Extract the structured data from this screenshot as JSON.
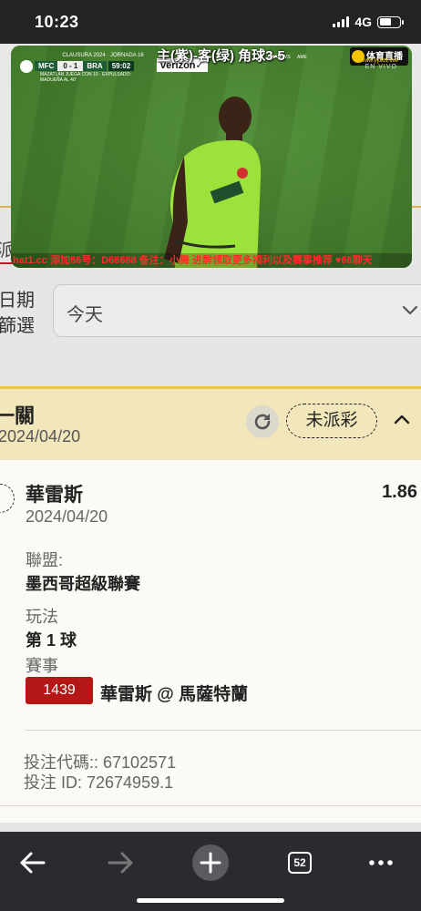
{
  "status_bar": {
    "time": "10:23",
    "network": "4G",
    "battery_level": 0.6
  },
  "video": {
    "title": "主(紫)-客(绿) 角球3-5",
    "scorebug": {
      "league": "CLAUSURA 2024 · JORNADA 16",
      "home": "MFC",
      "score": "0 - 1",
      "away": "BRA",
      "clock": "59:02",
      "sponsor": "verizon✓",
      "note": "MAZATLÁN JUEGA CON 10 · EXPULSADO: MADUEÑA AL 40'"
    },
    "mini_teams": [
      "UNAM",
      "VS",
      "AME"
    ],
    "live_logo": "体育直播",
    "live_url": "www.yyzb1.live",
    "en_vivo": "EN VIVO",
    "ticker": "hat1.cc  添加66号：D66668  备注：小舞  进群领取更多福利以及赛事推荐  ♥66聊天"
  },
  "page": {
    "tab_fragment": "派",
    "date_filter_label": "日期\n篩選",
    "date_filter_value": "今天"
  },
  "bet_card": {
    "bet_type": "一關",
    "header_date": "2024/04/20",
    "status": "未派彩",
    "selection": "華雷斯",
    "odds": "1.86",
    "selection_date": "2024/04/20",
    "league_label": "聯盟:",
    "league_value": "墨西哥超級聯賽",
    "market_label": "玩法",
    "market_value": "第 1 球",
    "event_label": "賽事",
    "event_id": "1439",
    "event_name": "華雷斯 @ 馬薩特蘭",
    "bet_code": "投注代碼:: 67102571",
    "bet_id": "投注 ID: 72674959.1"
  },
  "toolbar": {
    "tab_count": "52"
  },
  "colors": {
    "accent_red": "#b51616",
    "card_header": "#f2e6bb",
    "card_border": "#e9c84a",
    "toolbar_bg": "#2a2b2f",
    "jersey": "#9be23a"
  }
}
